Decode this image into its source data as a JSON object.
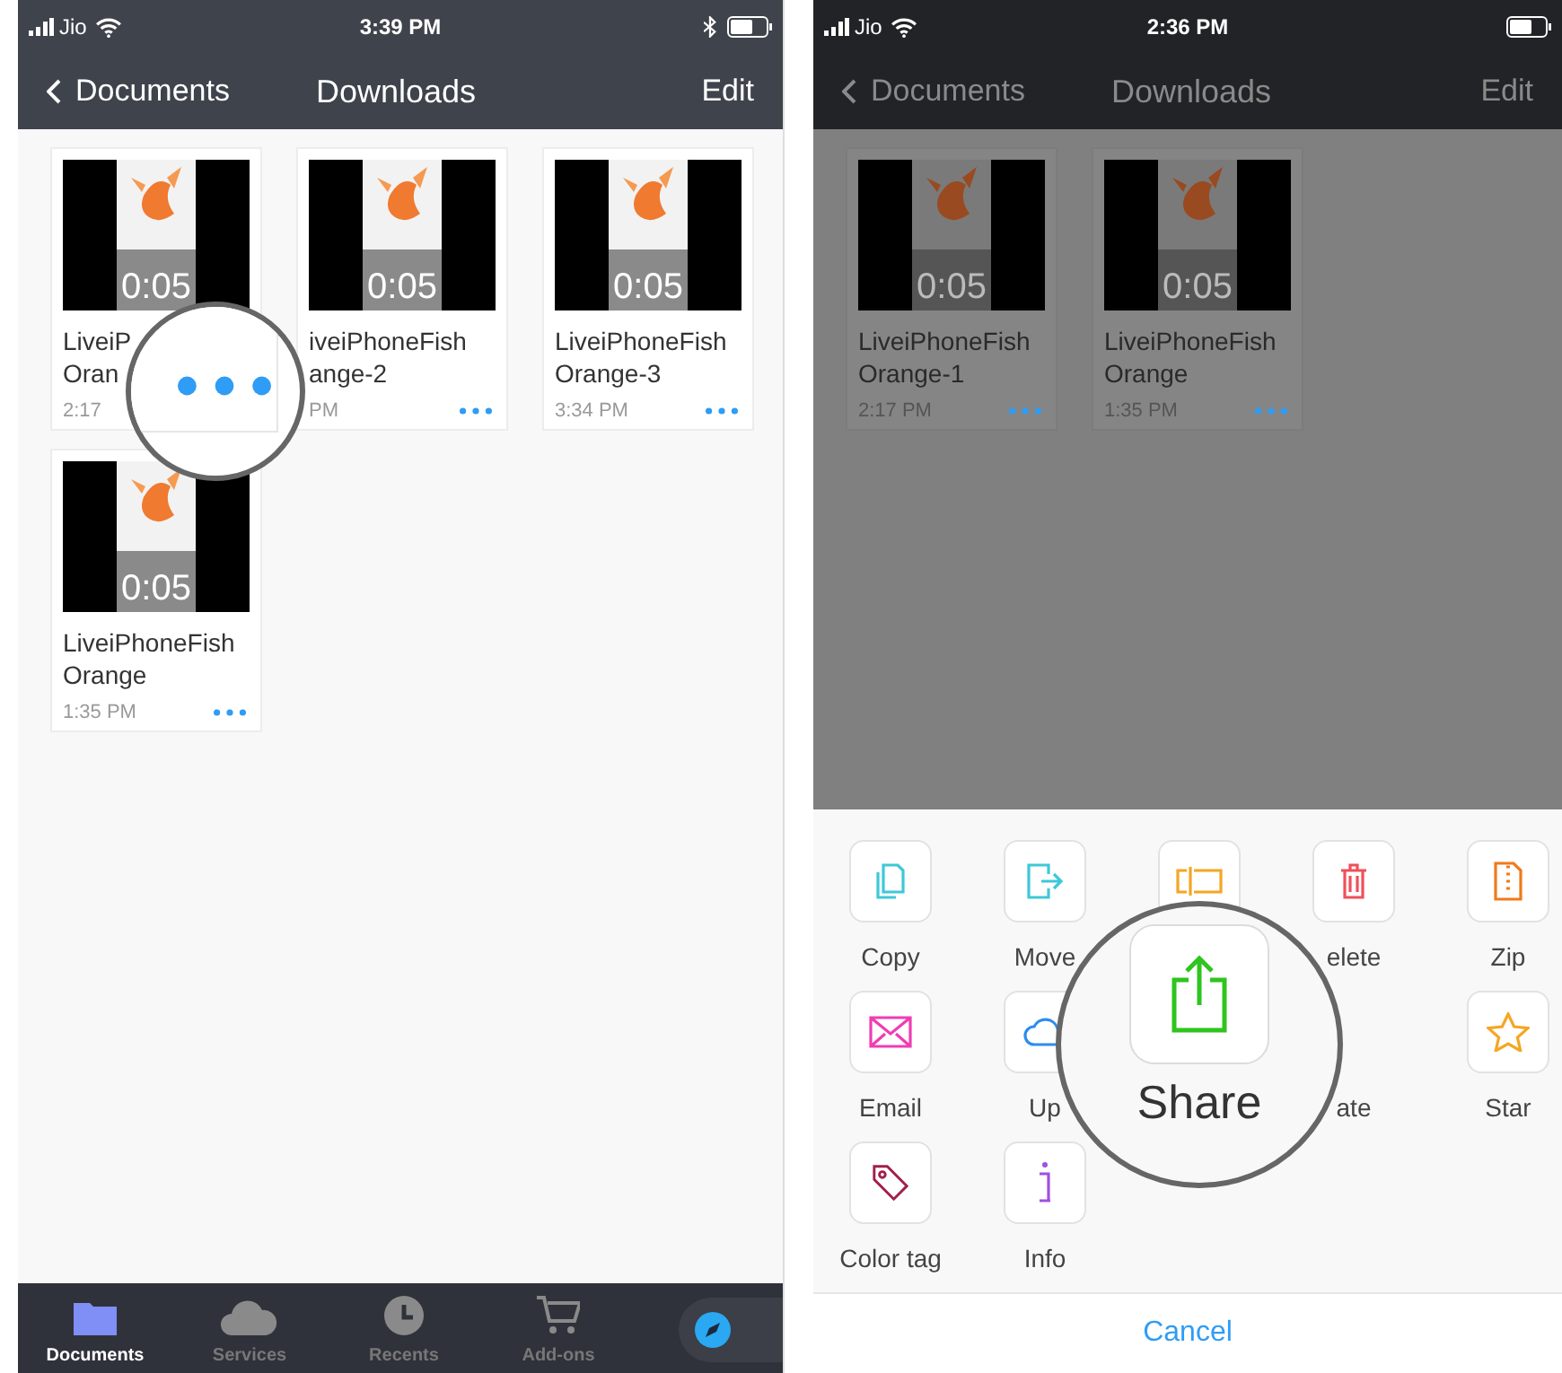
{
  "screens": [
    {
      "dimmed": false,
      "status_bar": {
        "carrier": "Jio",
        "time": "3:39 PM",
        "bluetooth": true
      },
      "nav": {
        "back": "Documents",
        "title": "Downloads",
        "action": "Edit"
      },
      "files": [
        {
          "duration": "0:05",
          "name_lines": [
            "LiveiP",
            "Oran"
          ],
          "time": "2:17"
        },
        {
          "duration": "0:05",
          "name_lines": [
            "iveiPhoneFish",
            "ange-2"
          ],
          "time": "PM",
          "menu_visible": true
        },
        {
          "duration": "0:05",
          "name_lines": [
            "LiveiPhoneFish",
            "Orange-3"
          ],
          "time": "3:34 PM",
          "menu_visible": true
        },
        {
          "duration": "0:05",
          "name_lines": [
            "LiveiPhoneFish",
            "Orange"
          ],
          "time": "1:35 PM",
          "menu_visible": true
        }
      ],
      "tab_bar": [
        {
          "kind": "folder",
          "label": "Documents",
          "selected": true
        },
        {
          "kind": "cloud",
          "label": "Services",
          "selected": false
        },
        {
          "kind": "clock",
          "label": "Recents",
          "selected": false
        },
        {
          "kind": "cart",
          "label": "Add-ons",
          "selected": false
        }
      ]
    },
    {
      "dimmed": true,
      "status_bar": {
        "carrier": "Jio",
        "time": "2:36 PM",
        "bluetooth": false
      },
      "nav": {
        "back": "Documents",
        "title": "Downloads",
        "action": "Edit"
      },
      "files": [
        {
          "duration": "0:05",
          "name_lines": [
            "LiveiPhoneFish",
            "Orange-1"
          ],
          "time": "2:17 PM",
          "menu_visible": true
        },
        {
          "duration": "0:05",
          "name_lines": [
            "LiveiPhoneFish",
            "Orange"
          ],
          "time": "1:35 PM",
          "menu_visible": true
        }
      ],
      "action_sheet": {
        "actions": [
          {
            "kind": "copy",
            "label": "Copy",
            "color": "#3ec8d8"
          },
          {
            "kind": "move",
            "label": "Move",
            "color": "#3ec8d8"
          },
          {
            "kind": "rename",
            "color": "#f5a623"
          },
          {
            "kind": "delete",
            "label": "elete",
            "color": "#f0505a"
          },
          {
            "kind": "zip",
            "label": "Zip",
            "color": "#f07a1a"
          },
          {
            "kind": "email",
            "label": "Email",
            "color": "#f03cb4"
          },
          {
            "kind": "upload",
            "label": "Up",
            "color": "#2d8cf0"
          },
          {
            "kind": "hidden"
          },
          {
            "kind": "hidden",
            "label": "ate"
          },
          {
            "kind": "star",
            "label": "Star",
            "color": "#f5a623"
          },
          {
            "kind": "tag",
            "label": "Color tag",
            "color": "#a0204a"
          },
          {
            "kind": "info",
            "label": "Info",
            "color": "#a050e0"
          }
        ],
        "cancel": "Cancel"
      }
    }
  ],
  "magnifiers": [
    {
      "kind": "dots"
    },
    {
      "kind": "share",
      "label": "Share"
    }
  ]
}
